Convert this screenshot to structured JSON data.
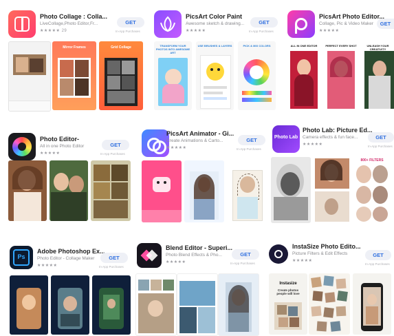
{
  "apps": [
    {
      "name": "Photo Collage : Colla...",
      "subtitle": "LiveCollage,Photo Editor,Fr...",
      "rating_count": "29",
      "get": "GET",
      "in_app": "In-App Purchases",
      "icon": "collage-icon",
      "screens": [
        {
          "caption": ""
        },
        {
          "caption": "Mirror Frames"
        },
        {
          "caption": "Grid Collage"
        }
      ]
    },
    {
      "name": "PicsArt Color Paint",
      "subtitle": "Awesome sketch & drawing...",
      "rating_count": "",
      "get": "GET",
      "in_app": "In-App Purchases",
      "icon": "lotus-icon",
      "screens": [
        {
          "caption": "TRANSFORM YOUR PHOTOS INTO AWESOME ART"
        },
        {
          "caption": "USE BRUSHES & LAYERS"
        },
        {
          "caption": "PICK & MIX COLORS"
        }
      ]
    },
    {
      "name": "PicsArt Photo Editor...",
      "subtitle": "Collage, Pic & Video Maker",
      "rating_count": "",
      "get": "GET",
      "in_app": "In-App Purchases",
      "icon": "picsart-icon",
      "screens": [
        {
          "caption": "ALL IN ONE EDITOR"
        },
        {
          "caption": "PERFECT EVERY SHOT"
        },
        {
          "caption": "UNLEASH YOUR CREATIVITY"
        }
      ]
    },
    {
      "name": "Photo Editor-",
      "subtitle": "All in one Photo Editor",
      "rating_count": "",
      "get": "GET",
      "in_app": "In-App Purchases",
      "icon": "aperture-icon",
      "screens": [
        {
          "caption": ""
        },
        {
          "caption": ""
        },
        {
          "caption": ""
        }
      ]
    },
    {
      "name": "PicsArt Animator - Gi...",
      "subtitle": "Create Animations & Carto...",
      "rating_count": "",
      "get": "GET",
      "in_app": "In-App Purchases",
      "icon": "animator-icon",
      "screens": [
        {
          "caption": ""
        },
        {
          "caption": ""
        },
        {
          "caption": ""
        }
      ]
    },
    {
      "name": "Photo Lab: Picture Ed...",
      "subtitle": "Camera effects & fun face...",
      "rating_count": "",
      "get": "GET",
      "in_app": "In-App Purchases",
      "icon": "photo-lab-icon",
      "icon_text": "Photo Lab",
      "screens": [
        {
          "caption": ""
        },
        {
          "caption": ""
        },
        {
          "caption": "800+ FILTERS"
        }
      ]
    },
    {
      "name": "Adobe Photoshop Ex...",
      "subtitle": "Photo Editor - Collage Maker",
      "rating_count": "",
      "get": "GET",
      "in_app": "In-App Purchases",
      "icon": "adobe-ps-icon",
      "icon_text": "Ps",
      "screens": [
        {
          "caption": ""
        },
        {
          "caption": ""
        },
        {
          "caption": ""
        }
      ]
    },
    {
      "name": "Blend Editor - Superi...",
      "subtitle": "Photo Blend Effects & Pho...",
      "rating_count": "",
      "get": "GET",
      "in_app": "In-App Purchases",
      "icon": "blend-icon",
      "screens": [
        {
          "caption": ""
        },
        {
          "caption": ""
        },
        {
          "caption": ""
        }
      ]
    },
    {
      "name": "InstaSize Photo Edito...",
      "subtitle": "Picture Filters & Edit Effects",
      "rating_count": "",
      "get": "GET",
      "in_app": "In-App Purchases",
      "icon": "instasize-icon",
      "screens": [
        {
          "caption": "Instasize"
        },
        {
          "caption": ""
        },
        {
          "caption": ""
        }
      ]
    }
  ],
  "promo": {
    "instasize_tagline": "Create photos people will love"
  },
  "stars": "★★★★★"
}
